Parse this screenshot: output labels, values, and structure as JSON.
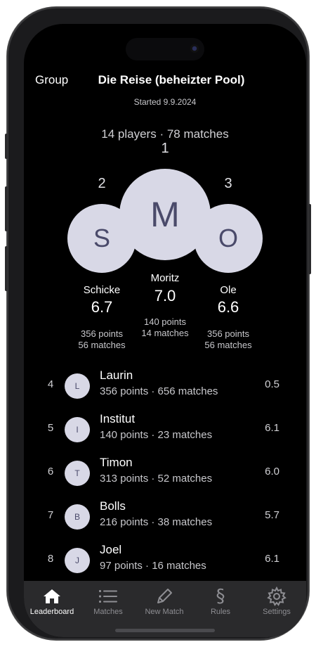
{
  "header": {
    "back_label": "Group",
    "title": "Die Reise (beheizter Pool)",
    "subtitle": "Started 9.9.2024"
  },
  "summary": "14 players · 78 matches",
  "podium": {
    "first": {
      "rank": "1",
      "initial": "M",
      "name": "Moritz",
      "score": "7.0",
      "points": "140 points",
      "matches": "14 matches"
    },
    "second": {
      "rank": "2",
      "initial": "S",
      "name": "Schicke",
      "score": "6.7",
      "points": "356 points",
      "matches": "56 matches"
    },
    "third": {
      "rank": "3",
      "initial": "O",
      "name": "Ole",
      "score": "6.6",
      "points": "356 points",
      "matches": "56 matches"
    }
  },
  "players": [
    {
      "rank": "4",
      "initial": "L",
      "name": "Laurin",
      "meta": "356 points · 656 matches",
      "score": "0.5"
    },
    {
      "rank": "5",
      "initial": "I",
      "name": "Institut",
      "meta": "140 points · 23 matches",
      "score": "6.1"
    },
    {
      "rank": "6",
      "initial": "T",
      "name": "Timon",
      "meta": "313 points · 52 matches",
      "score": "6.0"
    },
    {
      "rank": "7",
      "initial": "B",
      "name": "Bolls",
      "meta": "216 points · 38 matches",
      "score": "5.7"
    },
    {
      "rank": "8",
      "initial": "J",
      "name": "Joel",
      "meta": "97 points · 16 matches",
      "score": "6.1"
    }
  ],
  "tabs": [
    {
      "label": "Leaderboard",
      "icon": "house-icon",
      "active": true
    },
    {
      "label": "Matches",
      "icon": "list-icon",
      "active": false
    },
    {
      "label": "New Match",
      "icon": "pencil-icon",
      "active": false
    },
    {
      "label": "Rules",
      "icon": "section-icon",
      "active": false
    },
    {
      "label": "Settings",
      "icon": "gear-icon",
      "active": false
    }
  ]
}
